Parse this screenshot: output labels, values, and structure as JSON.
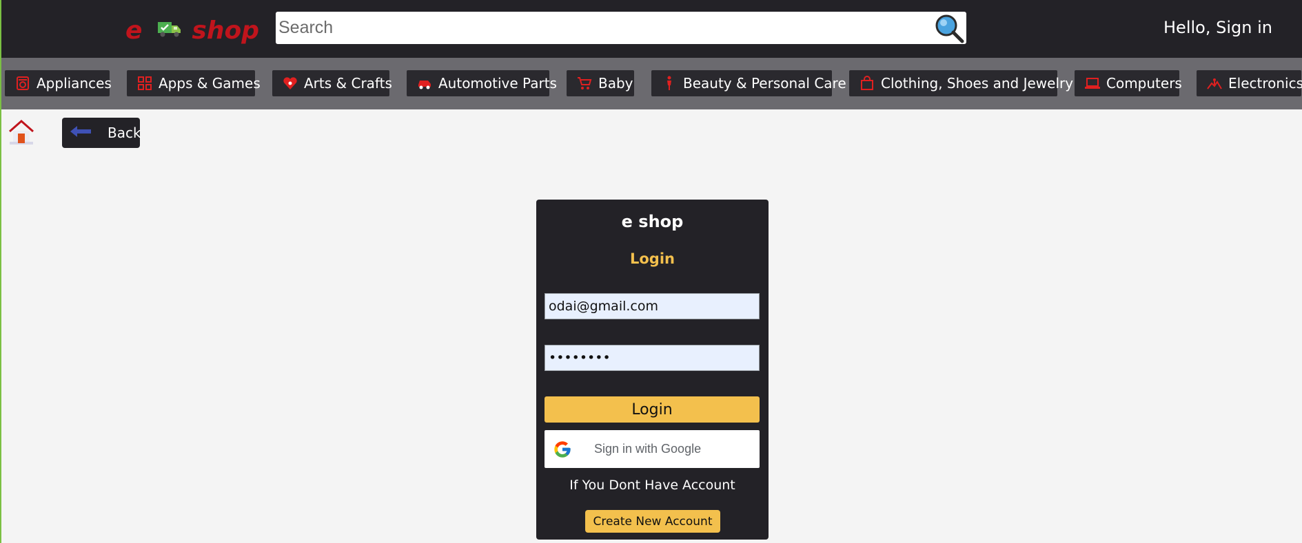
{
  "header": {
    "logo_left": "e",
    "logo_right": "shop",
    "search_placeholder": "Search",
    "signin_label": "Hello, Sign in"
  },
  "categories": [
    {
      "label": "Appliances",
      "icon": "appliance-icon"
    },
    {
      "label": "Apps & Games",
      "icon": "apps-grid-icon"
    },
    {
      "label": "Arts & Crafts",
      "icon": "heart-icon"
    },
    {
      "label": "Automotive Parts",
      "icon": "car-icon"
    },
    {
      "label": "Baby",
      "icon": "stroller-icon"
    },
    {
      "label": "Beauty & Personal Care",
      "icon": "person-icon"
    },
    {
      "label": "Clothing, Shoes and Jewelry",
      "icon": "shopping-bag-icon"
    },
    {
      "label": "Computers",
      "icon": "laptop-icon"
    },
    {
      "label": "Electronics",
      "icon": "electronics-icon"
    }
  ],
  "nav": {
    "back_label": "Back"
  },
  "login": {
    "brand": "e shop",
    "title": "Login",
    "email_value": "odai@gmail.com",
    "password_value": "12345678",
    "login_button": "Login",
    "google_button": "Sign in with Google",
    "no_account_text": "If You Dont Have Account",
    "create_account_button": "Create New Account"
  },
  "colors": {
    "header_bg": "#232227",
    "catbar_bg": "#6b6a6f",
    "accent_yellow": "#f3c04d",
    "brand_red": "#c0141c",
    "page_bg": "#f4f4f4"
  }
}
